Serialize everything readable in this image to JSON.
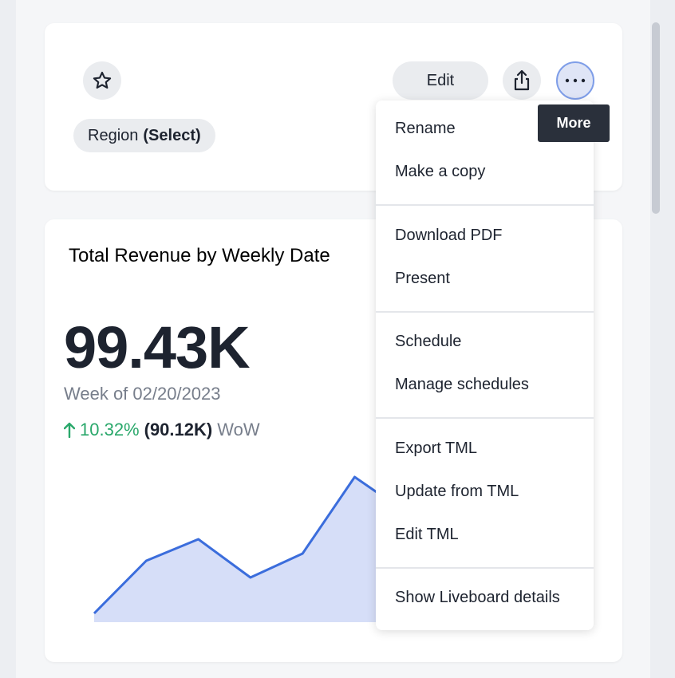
{
  "header": {
    "edit_label": "Edit",
    "filter": {
      "name": "Region",
      "value": "(Select)"
    }
  },
  "tooltip": {
    "text": "More"
  },
  "menu": {
    "items": [
      "Rename",
      "Make a copy",
      "Download PDF",
      "Present",
      "Schedule",
      "Manage schedules",
      "Export TML",
      "Update from TML",
      "Edit TML",
      "Show Liveboard details"
    ]
  },
  "chart": {
    "title": "Total Revenue by Weekly Date",
    "kpi_value": "99.43K",
    "period": "Week of 02/20/2023",
    "change_pct": "10.32%",
    "prev_value": "(90.12K)",
    "comparison": "WoW",
    "colors": {
      "line": "#3b6ddc",
      "fill": "#d6def8",
      "up": "#2aa86b"
    }
  },
  "chart_data": {
    "type": "area",
    "title": "",
    "xlabel": "",
    "ylabel": "",
    "values": [
      62,
      84,
      93,
      77,
      87,
      119,
      104
    ]
  }
}
